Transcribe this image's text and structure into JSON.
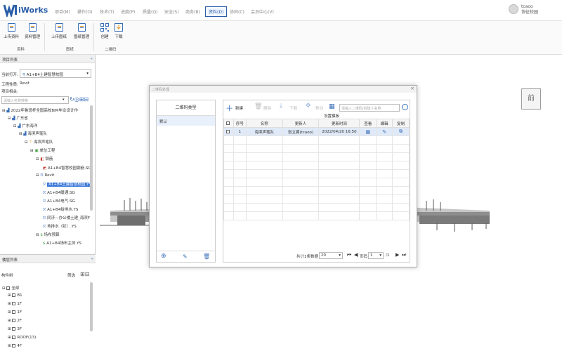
{
  "app": {
    "name": "iWorks"
  },
  "nav": {
    "items": [
      "项目(M)",
      "操作(O)",
      "技术(T)",
      "进度(P)",
      "质量(Q)",
      "安全(S)",
      "商务(B)",
      "资料(D)",
      "协同(C)",
      "会员中心(V)"
    ],
    "active_index": 7
  },
  "user": {
    "name": "tcaoo",
    "org": "协征校园"
  },
  "ribbon": {
    "buttons": [
      "上传资料",
      "资料管理",
      "上传图纸",
      "图纸管理",
      "创建",
      "下载"
    ],
    "groups": [
      "资料",
      "图纸",
      "二维码"
    ]
  },
  "left": {
    "project_list_title": "项目列表",
    "current_label": "当前打开:",
    "current_value": "A1+B4土建智慧校园",
    "nature_label": "工程性质:",
    "nature_value": "Revit",
    "related_label": "项目相关:",
    "search_placeholder": "请输入名称搜索",
    "tree": [
      "2022年鲁班杯全国高校BIM毕业设计作",
      "广东省",
      "广东海洋",
      "海滨声笔队",
      "海滨声笔队",
      "单位工程",
      "钢筋",
      "A1+B4智慧校园钢筋.SG",
      "Revit",
      "A1+B4土建智慧校园.YS",
      "A1+B4暖通.SG",
      "A1+B4电气.SG",
      "A1+B4给排水.YS",
      "同济—办公楼土建_海滨F",
      "地排水（虹）.YS",
      "场布预算",
      "A1+B4场布主体.YS"
    ],
    "selected_tree_index": 9,
    "layer_title": "楼层列表",
    "component_label": "构件树",
    "filter_label": "筛选",
    "layers": [
      "全部",
      "B1",
      "1F",
      "1F",
      "2F",
      "3F",
      "ROOF(13)",
      "4F"
    ]
  },
  "dialog": {
    "title": "二维码处理",
    "type_header": "二维码类型",
    "types": [
      "默认"
    ],
    "toolbar": {
      "new": "新建",
      "delete": "删除",
      "download": "下载",
      "move": "移动",
      "template": "设置模板"
    },
    "search_placeholder": "请输入二维码/创建人名称",
    "columns": [
      "序号",
      "名称",
      "更新人",
      "更新时间",
      "查看",
      "编辑",
      "复制"
    ],
    "rows": [
      {
        "no": "1",
        "name": "海滨声笔队",
        "updater": "张立翼(tcaoo)",
        "time": "2022/04/20 16:50"
      }
    ],
    "pager": {
      "total": "共计1条数据",
      "size": "20",
      "page_label": "页码",
      "page": "1",
      "pages": "/1"
    }
  },
  "scene": {
    "front_label": "前"
  }
}
